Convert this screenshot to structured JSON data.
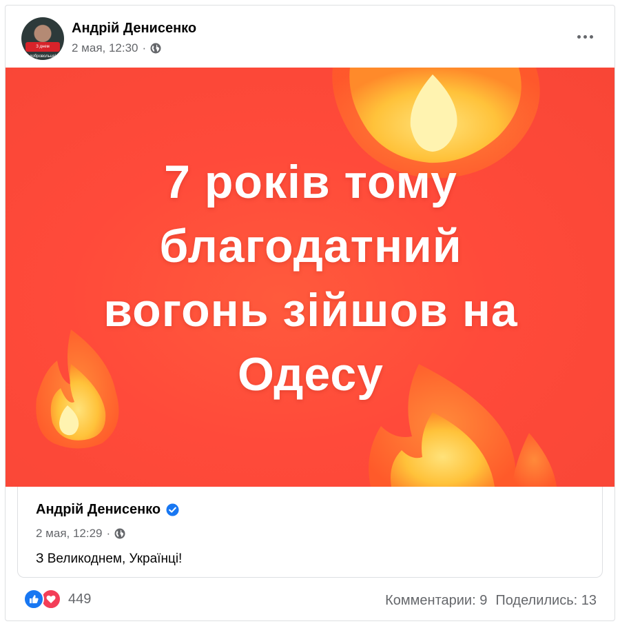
{
  "post": {
    "author": "Андрій Денисенко",
    "timestamp": "2 мая, 12:30",
    "separator": "·",
    "privacy_icon": "globe-icon",
    "avatar_caption": "З днем добровольця!",
    "image_text_lines": [
      "7 років тому",
      "благодатний",
      "вогонь зійшов на",
      "Одесу"
    ]
  },
  "shared_post": {
    "author": "Андрій Денисенко",
    "verified_icon": "verified-badge-icon",
    "timestamp": "2 мая, 12:29",
    "separator": "·",
    "text": "З Великоднем, Українці!"
  },
  "footer": {
    "reactions": [
      "like-icon",
      "love-icon"
    ],
    "reaction_count": "449",
    "comments_label": "Комментарии: 9",
    "shares_label": "Поделились: 13"
  },
  "colors": {
    "image_background": "#ff4a3a",
    "like": "#1877f2",
    "love": "#f33e58",
    "verified": "#1877f2"
  }
}
